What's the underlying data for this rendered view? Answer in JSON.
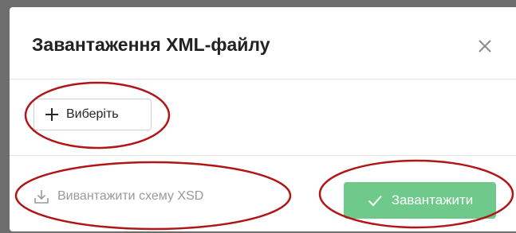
{
  "dialog": {
    "title": "Завантаження XML-файлу",
    "close_icon": "close-icon"
  },
  "body": {
    "select_button_icon": "plus-icon",
    "select_button_label": "Виберіть"
  },
  "footer": {
    "download_icon": "download-icon",
    "download_label": "Вивантажити схему XSD",
    "upload_icon": "check-icon",
    "upload_label": "Завантажити"
  },
  "colors": {
    "upload_button": "#6fc98a",
    "annotation_ellipse": "#b21515",
    "backdrop": "#6e6e6e"
  }
}
